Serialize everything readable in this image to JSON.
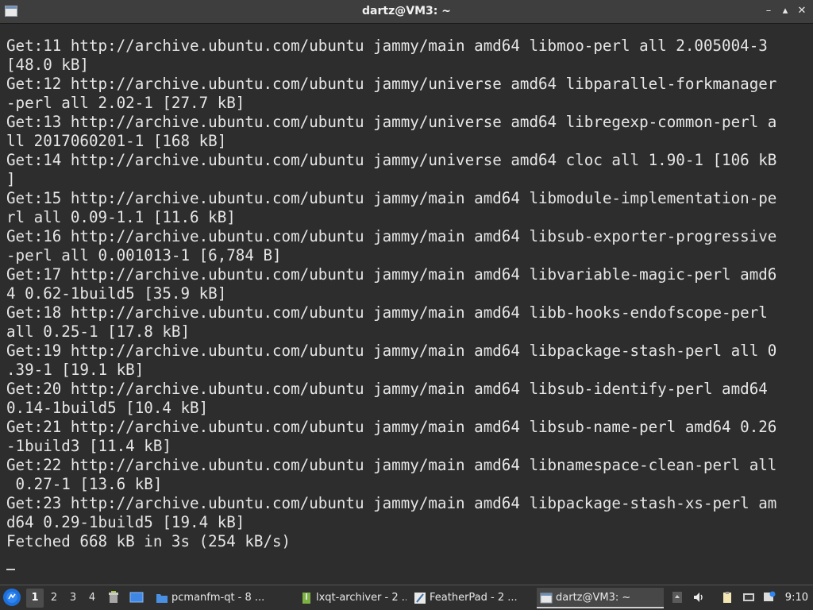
{
  "window": {
    "title": "dartz@VM3: ~"
  },
  "terminal": {
    "lines": [
      "Get:11 http://archive.ubuntu.com/ubuntu jammy/main amd64 libmoo-perl all 2.005004-3",
      "[48.0 kB]",
      "Get:12 http://archive.ubuntu.com/ubuntu jammy/universe amd64 libparallel-forkmanager",
      "-perl all 2.02-1 [27.7 kB]",
      "Get:13 http://archive.ubuntu.com/ubuntu jammy/universe amd64 libregexp-common-perl a",
      "ll 2017060201-1 [168 kB]",
      "Get:14 http://archive.ubuntu.com/ubuntu jammy/universe amd64 cloc all 1.90-1 [106 kB",
      "]",
      "Get:15 http://archive.ubuntu.com/ubuntu jammy/main amd64 libmodule-implementation-pe",
      "rl all 0.09-1.1 [11.6 kB]",
      "Get:16 http://archive.ubuntu.com/ubuntu jammy/main amd64 libsub-exporter-progressive",
      "-perl all 0.001013-1 [6,784 B]",
      "Get:17 http://archive.ubuntu.com/ubuntu jammy/main amd64 libvariable-magic-perl amd6",
      "4 0.62-1build5 [35.9 kB]",
      "Get:18 http://archive.ubuntu.com/ubuntu jammy/main amd64 libb-hooks-endofscope-perl",
      "all 0.25-1 [17.8 kB]",
      "Get:19 http://archive.ubuntu.com/ubuntu jammy/main amd64 libpackage-stash-perl all 0",
      ".39-1 [19.1 kB]",
      "Get:20 http://archive.ubuntu.com/ubuntu jammy/main amd64 libsub-identify-perl amd64",
      "0.14-1build5 [10.4 kB]",
      "Get:21 http://archive.ubuntu.com/ubuntu jammy/main amd64 libsub-name-perl amd64 0.26",
      "-1build3 [11.4 kB]",
      "Get:22 http://archive.ubuntu.com/ubuntu jammy/main amd64 libnamespace-clean-perl all",
      " 0.27-1 [13.6 kB]",
      "Get:23 http://archive.ubuntu.com/ubuntu jammy/main amd64 libpackage-stash-xs-perl am",
      "d64 0.29-1build5 [19.4 kB]",
      "Fetched 668 kB in 3s (254 kB/s)"
    ]
  },
  "taskbar": {
    "desktops": [
      "1",
      "2",
      "3",
      "4"
    ],
    "active_desktop": "1",
    "tasks": [
      {
        "label": "pcmanfm-qt - 8 ...",
        "icon": "folder-icon"
      },
      {
        "label": "lxqt-archiver - 2 ...",
        "icon": "archive-icon"
      },
      {
        "label": "FeatherPad - 2 ...",
        "icon": "featherpad-icon"
      },
      {
        "label": "dartz@VM3: ~",
        "icon": "terminal-icon",
        "active": true
      }
    ],
    "clock": "9:10"
  },
  "colors": {
    "terminal_bg": "#2d2d2d",
    "terminal_fg": "#e6e6e6",
    "taskbar_bg": "#2f2f2f",
    "start_blue": "#1e6fd9"
  }
}
